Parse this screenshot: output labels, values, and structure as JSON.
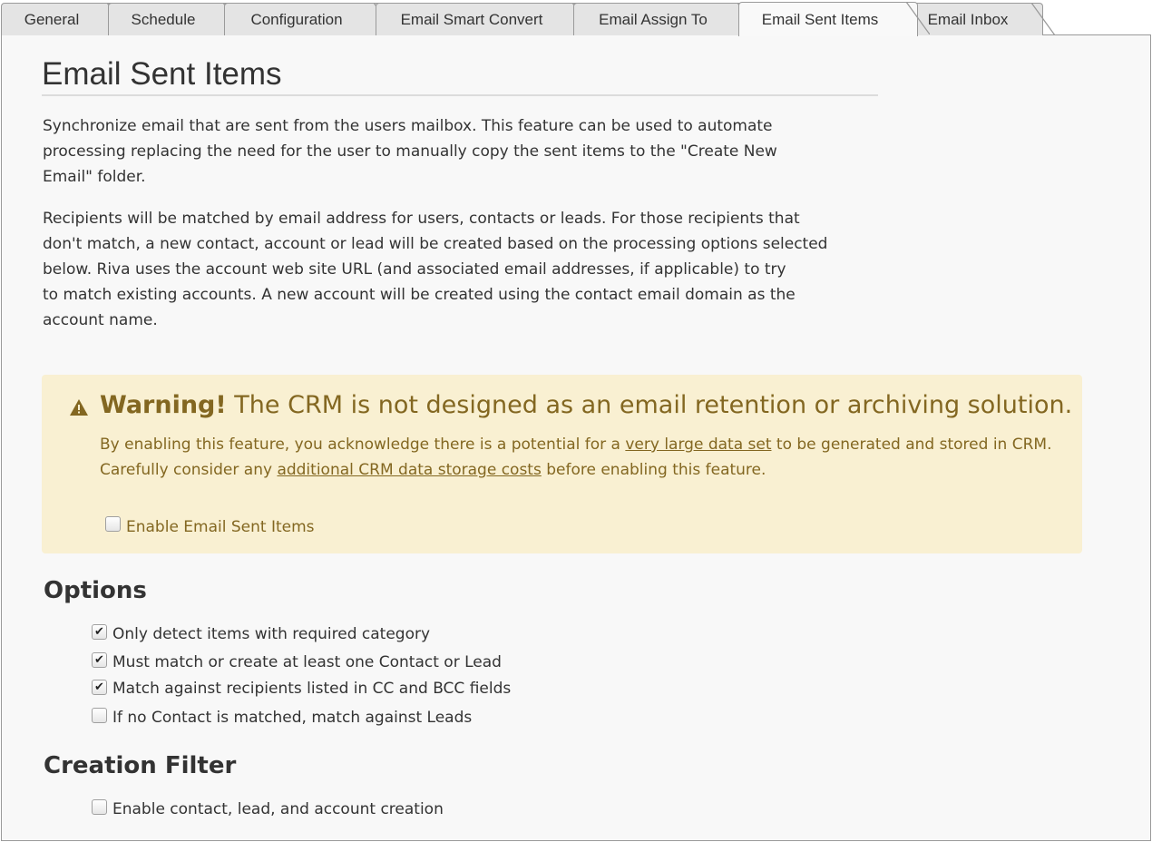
{
  "tabs": [
    {
      "label": "General"
    },
    {
      "label": "Schedule"
    },
    {
      "label": "Configuration"
    },
    {
      "label": "Email Smart Convert"
    },
    {
      "label": "Email Assign To"
    },
    {
      "label": "Email Sent Items",
      "active": true
    },
    {
      "label": "Email Inbox"
    }
  ],
  "page": {
    "title": "Email Sent Items",
    "para1": "Synchronize email that are sent from the users mailbox. This feature can be used to automate\nprocessing replacing the need for the user to manually copy the sent items to the \"Create New\nEmail\" folder.",
    "para2": "Recipients will be matched by email address for users, contacts or leads. For those recipients that\ndon't match, a new contact, account or lead will be created based on the processing options selected\nbelow. Riva uses the account web site URL (and associated email addresses, if applicable) to try\nto match existing accounts. A new account will be created using the contact email domain as the\naccount name."
  },
  "warning": {
    "icon": "warning-icon",
    "strong": "Warning!",
    "headline": "The CRM is not designed as an email retention or archiving solution.",
    "text_before": "By enabling this feature, you acknowledge there is a potential for a ",
    "link1": "very large data set",
    "text_middle": " to be generated and stored in CRM. Carefully consider any ",
    "link2": "additional CRM data storage costs",
    "text_after": " before enabling this feature.",
    "enable_label": "Enable Email Sent Items",
    "enable_checked": false,
    "color": "#836721",
    "background": "#f9f0d2"
  },
  "options": {
    "title": "Options",
    "items": [
      {
        "label": "Only detect items with required category",
        "checked": true
      },
      {
        "label": "Must match or create at least one Contact or Lead",
        "checked": true
      },
      {
        "label": "Match against recipients listed in CC and BCC fields",
        "checked": true
      },
      {
        "label": "If no Contact is matched, match against Leads",
        "checked": false
      }
    ]
  },
  "creation_filter": {
    "title": "Creation Filter",
    "items": [
      {
        "label": "Enable contact, lead, and account creation",
        "checked": false
      }
    ]
  }
}
